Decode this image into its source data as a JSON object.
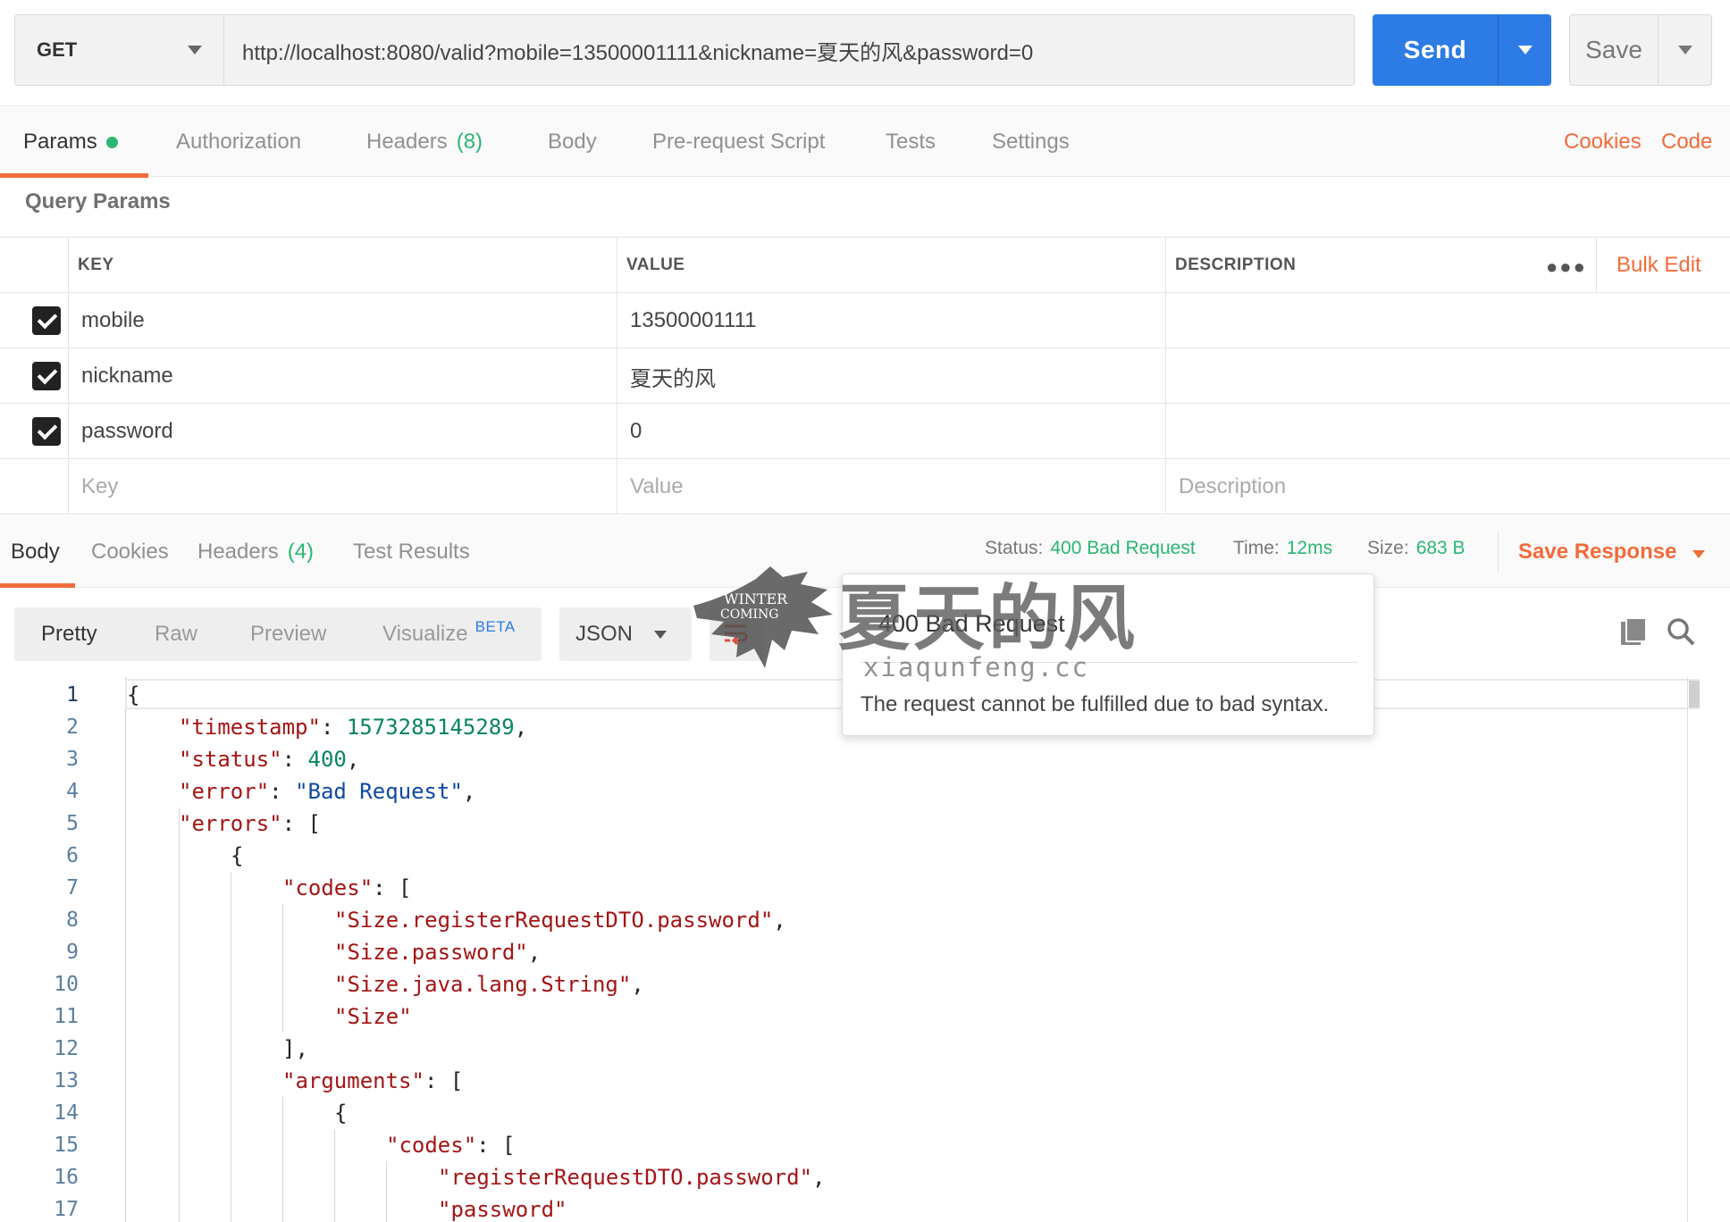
{
  "request": {
    "method": "GET",
    "url": "http://localhost:8080/valid?mobile=13500001111&nickname=夏天的风&password=0",
    "send_label": "Send",
    "save_label": "Save"
  },
  "request_tabs": [
    {
      "label": "Params",
      "count": ""
    },
    {
      "label": "Authorization",
      "count": ""
    },
    {
      "label": "Headers",
      "count": "(8)"
    },
    {
      "label": "Body",
      "count": ""
    },
    {
      "label": "Pre-request Script",
      "count": ""
    },
    {
      "label": "Tests",
      "count": ""
    },
    {
      "label": "Settings",
      "count": ""
    }
  ],
  "top_links": {
    "cookies": "Cookies",
    "code": "Code"
  },
  "query_params": {
    "title": "Query Params",
    "columns": {
      "key": "KEY",
      "value": "VALUE",
      "description": "DESCRIPTION"
    },
    "bulk_edit": "Bulk Edit",
    "rows": [
      {
        "key": "mobile",
        "value": "13500001111",
        "description": ""
      },
      {
        "key": "nickname",
        "value": "夏天的风",
        "description": ""
      },
      {
        "key": "password",
        "value": "0",
        "description": ""
      }
    ],
    "placeholders": {
      "key": "Key",
      "value": "Value",
      "description": "Description"
    }
  },
  "response_tabs": [
    {
      "label": "Body",
      "count": ""
    },
    {
      "label": "Cookies",
      "count": ""
    },
    {
      "label": "Headers",
      "count": "(4)"
    },
    {
      "label": "Test Results",
      "count": ""
    }
  ],
  "response_status": {
    "status_label": "Status:",
    "status_value": "400 Bad Request",
    "time_label": "Time:",
    "time_value": "12ms",
    "size_label": "Size:",
    "size_value": "683 B",
    "save_response": "Save Response"
  },
  "format_toolbar": {
    "modes": [
      "Pretty",
      "Raw",
      "Preview",
      "Visualize"
    ],
    "beta": "BETA",
    "language": "JSON"
  },
  "tooltip": {
    "title": "400 Bad Request",
    "description": "The request cannot be fulfilled due to bad syntax."
  },
  "watermark": {
    "big": "夏天的风",
    "small": "xiaqunfeng.cc",
    "logo_text": [
      "WINTER",
      "COMING"
    ]
  },
  "code": {
    "line_numbers": [
      "1",
      "2",
      "3",
      "4",
      "5",
      "6",
      "7",
      "8",
      "9",
      "10",
      "11",
      "12",
      "13",
      "14",
      "15",
      "16",
      "17"
    ],
    "lines": [
      {
        "indent": 0,
        "tokens": [
          {
            "t": "p",
            "v": "{"
          }
        ]
      },
      {
        "indent": 1,
        "tokens": [
          {
            "t": "k",
            "v": "\"timestamp\""
          },
          {
            "t": "p",
            "v": ": "
          },
          {
            "t": "n",
            "v": "1573285145289"
          },
          {
            "t": "p",
            "v": ","
          }
        ]
      },
      {
        "indent": 1,
        "tokens": [
          {
            "t": "k",
            "v": "\"status\""
          },
          {
            "t": "p",
            "v": ": "
          },
          {
            "t": "n",
            "v": "400"
          },
          {
            "t": "p",
            "v": ","
          }
        ]
      },
      {
        "indent": 1,
        "tokens": [
          {
            "t": "k",
            "v": "\"error\""
          },
          {
            "t": "p",
            "v": ": "
          },
          {
            "t": "s",
            "v": "\"Bad Request\""
          },
          {
            "t": "p",
            "v": ","
          }
        ]
      },
      {
        "indent": 1,
        "tokens": [
          {
            "t": "k",
            "v": "\"errors\""
          },
          {
            "t": "p",
            "v": ": ["
          }
        ]
      },
      {
        "indent": 2,
        "tokens": [
          {
            "t": "p",
            "v": "{"
          }
        ]
      },
      {
        "indent": 3,
        "tokens": [
          {
            "t": "k",
            "v": "\"codes\""
          },
          {
            "t": "p",
            "v": ": ["
          }
        ]
      },
      {
        "indent": 4,
        "tokens": [
          {
            "t": "sr",
            "v": "\"Size.registerRequestDTO.password\""
          },
          {
            "t": "p",
            "v": ","
          }
        ]
      },
      {
        "indent": 4,
        "tokens": [
          {
            "t": "sr",
            "v": "\"Size.password\""
          },
          {
            "t": "p",
            "v": ","
          }
        ]
      },
      {
        "indent": 4,
        "tokens": [
          {
            "t": "sr",
            "v": "\"Size.java.lang.String\""
          },
          {
            "t": "p",
            "v": ","
          }
        ]
      },
      {
        "indent": 4,
        "tokens": [
          {
            "t": "sr",
            "v": "\"Size\""
          }
        ]
      },
      {
        "indent": 3,
        "tokens": [
          {
            "t": "p",
            "v": "],"
          }
        ]
      },
      {
        "indent": 3,
        "tokens": [
          {
            "t": "k",
            "v": "\"arguments\""
          },
          {
            "t": "p",
            "v": ": ["
          }
        ]
      },
      {
        "indent": 4,
        "tokens": [
          {
            "t": "p",
            "v": "{"
          }
        ]
      },
      {
        "indent": 5,
        "tokens": [
          {
            "t": "k",
            "v": "\"codes\""
          },
          {
            "t": "p",
            "v": ": ["
          }
        ]
      },
      {
        "indent": 6,
        "tokens": [
          {
            "t": "sr",
            "v": "\"registerRequestDTO.password\""
          },
          {
            "t": "p",
            "v": ","
          }
        ]
      },
      {
        "indent": 6,
        "tokens": [
          {
            "t": "sr",
            "v": "\"password\""
          }
        ]
      }
    ]
  }
}
